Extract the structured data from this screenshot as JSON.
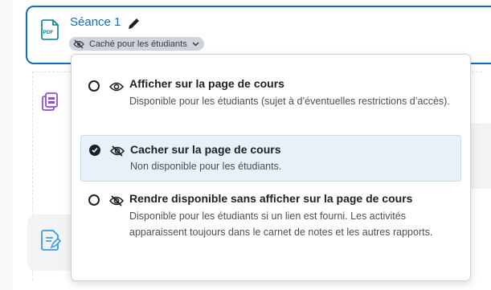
{
  "activity": {
    "title": "Séance 1",
    "type_icon": "pdf-file-icon",
    "visibility_badge": "Caché pour les étudiants"
  },
  "background_icons": [
    "copy-pages-icon",
    "assignment-icon"
  ],
  "visibility_menu": {
    "options": [
      {
        "icon": "eye-icon",
        "title": "Afficher sur la page de cours",
        "description": "Disponible pour les étudiants (sujet à d’éventuelles restrictions d’accès).",
        "selected": false
      },
      {
        "icon": "eye-slash-icon",
        "title": "Cacher sur la page de cours",
        "description": "Non disponible pour les étudiants.",
        "selected": true
      },
      {
        "icon": "eye-slash-icon",
        "title": "Rendre disponible sans afficher sur la page de cours",
        "description": "Disponible pour les étudiants si un lien est fourni. Les activités apparaissent toujours dans le carnet de notes et les autres rapports.",
        "selected": false
      }
    ]
  },
  "colors": {
    "accent": "#0f6cbf",
    "pdf_icon": "#008196",
    "copy_icon": "#8f4fd1",
    "assignment_icon": "#399be2",
    "selected_bg": "#e7f1fa",
    "badge_bg": "#ced4da"
  }
}
